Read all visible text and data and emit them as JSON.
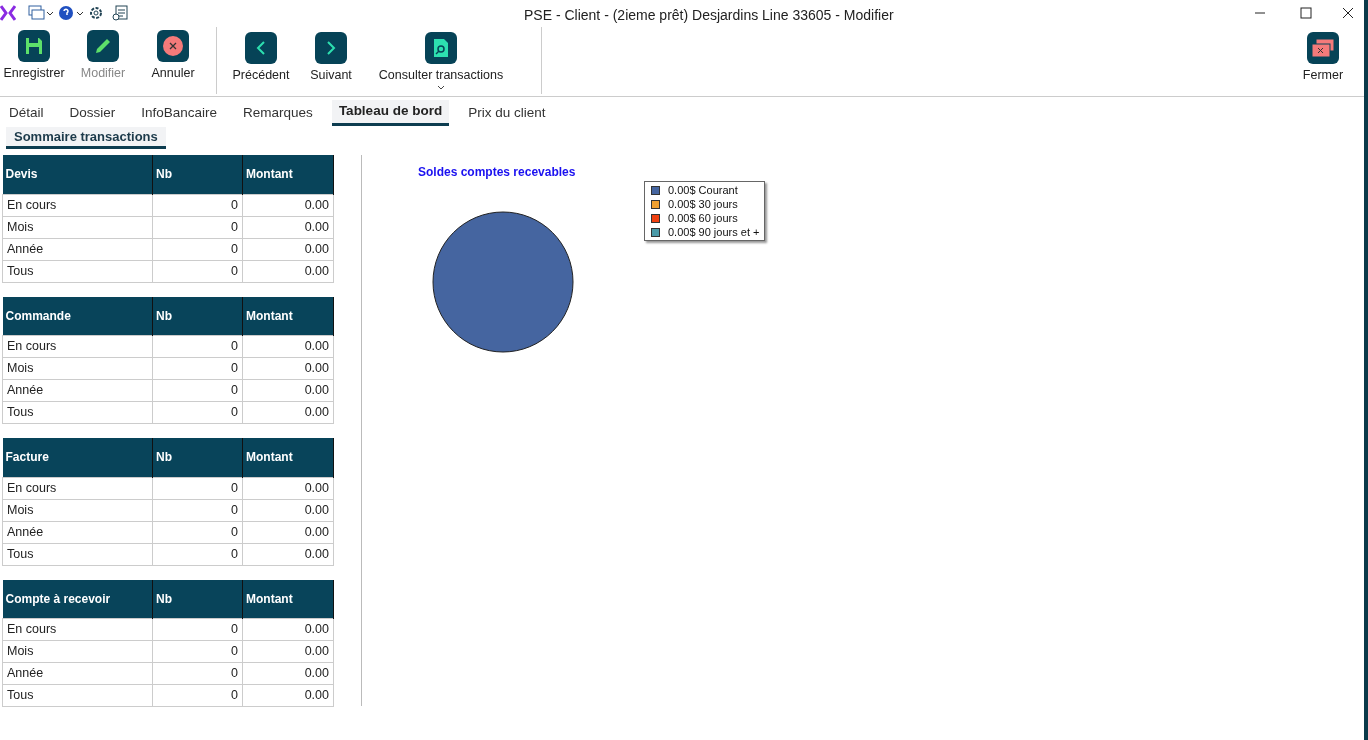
{
  "window": {
    "title": "PSE - Client - (2ieme prêt) Desjardins Line 33605 - Modifier"
  },
  "toolbar": [
    {
      "kind": "save",
      "label": "Enregistrer",
      "disabled": false
    },
    {
      "kind": "edit",
      "label": "Modifier",
      "disabled": true
    },
    {
      "kind": "cancel",
      "label": "Annuler",
      "disabled": false
    },
    {
      "kind": "prev",
      "label": "Précédent",
      "disabled": false
    },
    {
      "kind": "next",
      "label": "Suivant",
      "disabled": false
    },
    {
      "kind": "consult",
      "label": "Consulter transactions",
      "disabled": false
    },
    {
      "kind": "close",
      "label": "Fermer",
      "disabled": false
    }
  ],
  "tabs": [
    {
      "label": "Détail",
      "selected": false
    },
    {
      "label": "Dossier",
      "selected": false
    },
    {
      "label": "InfoBancaire",
      "selected": false
    },
    {
      "label": "Remarques",
      "selected": false
    },
    {
      "label": "Tableau de bord",
      "selected": true
    },
    {
      "label": "Prix du client",
      "selected": false
    }
  ],
  "subtabs": [
    {
      "label": "Sommaire transactions",
      "selected": true
    }
  ],
  "tables": [
    {
      "columns": [
        "Devis",
        "Nb",
        "Montant"
      ],
      "rows": [
        [
          "En cours",
          "0",
          "0.00"
        ],
        [
          "Mois",
          "0",
          "0.00"
        ],
        [
          "Année",
          "0",
          "0.00"
        ],
        [
          "Tous",
          "0",
          "0.00"
        ]
      ]
    },
    {
      "columns": [
        "Commande",
        "Nb",
        "Montant"
      ],
      "rows": [
        [
          "En cours",
          "0",
          "0.00"
        ],
        [
          "Mois",
          "0",
          "0.00"
        ],
        [
          "Année",
          "0",
          "0.00"
        ],
        [
          "Tous",
          "0",
          "0.00"
        ]
      ]
    },
    {
      "columns": [
        "Facture",
        "Nb",
        "Montant"
      ],
      "rows": [
        [
          "En cours",
          "0",
          "0.00"
        ],
        [
          "Mois",
          "0",
          "0.00"
        ],
        [
          "Année",
          "0",
          "0.00"
        ],
        [
          "Tous",
          "0",
          "0.00"
        ]
      ]
    },
    {
      "columns": [
        "Compte à recevoir",
        "Nb",
        "Montant"
      ],
      "rows": [
        [
          "En cours",
          "0",
          "0.00"
        ],
        [
          "Mois",
          "0",
          "0.00"
        ],
        [
          "Année",
          "0",
          "0.00"
        ],
        [
          "Tous",
          "0",
          "0.00"
        ]
      ]
    }
  ],
  "chart": {
    "title": "Soldes comptes recevables",
    "legend": [
      {
        "label": "0.00$ Courant",
        "color": "#4565a0"
      },
      {
        "label": "0.00$ 30 jours",
        "color": "#f0a030"
      },
      {
        "label": "0.00$ 60 jours",
        "color": "#f04010"
      },
      {
        "label": "0.00$ 90 jours et +",
        "color": "#4a9aa8"
      }
    ]
  }
}
